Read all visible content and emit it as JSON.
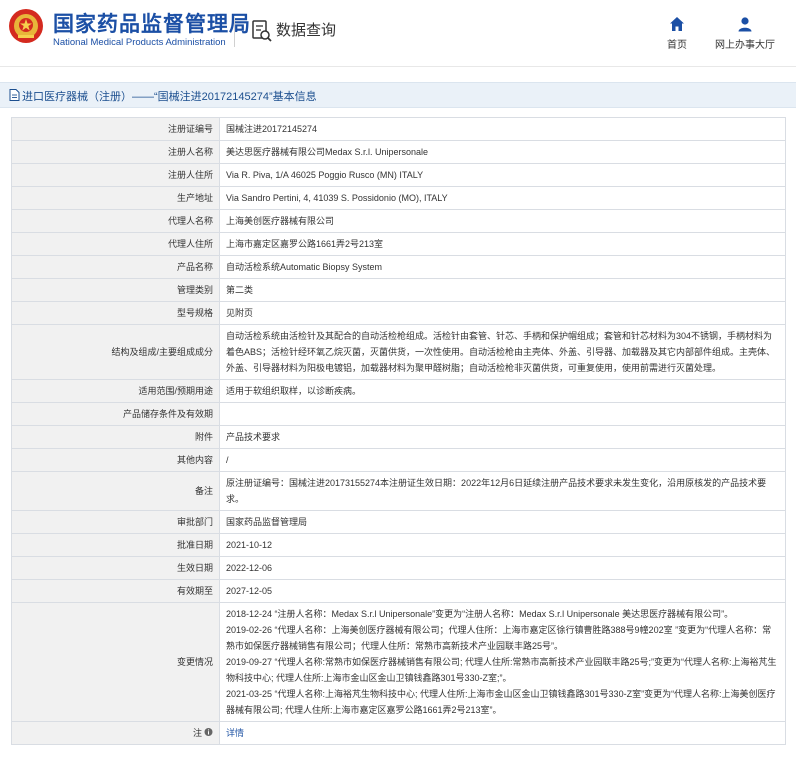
{
  "header": {
    "brand_cn": "国家药品监督管理局",
    "brand_en": "National Medical Products Administration",
    "query_title": "数据查询",
    "nav": {
      "home": "首页",
      "hall": "网上办事大厅"
    }
  },
  "title_bar": {
    "text": "进口医疗器械（注册）——“国械注进20172145274”基本信息"
  },
  "colors": {
    "brand_blue": "#1b4fa5",
    "label_bg": "#f1f1f1",
    "title_bar_bg": "#eaf1f8",
    "link": "#2356a5"
  },
  "rows": [
    {
      "label": "注册证编号",
      "value": "国械注进20172145274"
    },
    {
      "label": "注册人名称",
      "value": "美达思医疗器械有限公司Medax S.r.l. Unipersonale"
    },
    {
      "label": "注册人住所",
      "value": "Via R. Piva, 1/A 46025 Poggio Rusco (MN) ITALY"
    },
    {
      "label": "生产地址",
      "value": "Via Sandro Pertini, 4, 41039 S. Possidonio (MO), ITALY"
    },
    {
      "label": "代理人名称",
      "value": "上海美创医疗器械有限公司"
    },
    {
      "label": "代理人住所",
      "value": "上海市嘉定区嘉罗公路1661弄2号213室"
    },
    {
      "label": "产品名称",
      "value": "自动活检系统Automatic Biopsy System"
    },
    {
      "label": "管理类别",
      "value": "第二类"
    },
    {
      "label": "型号规格",
      "value": "见附页"
    },
    {
      "label": "结构及组成/主要组成成分",
      "value": "自动活检系统由活检针及其配合的自动活检枪组成。活检针由套管、针芯、手柄和保护帽组成；套管和针芯材料为304不锈钢，手柄材料为着色ABS；活检针经环氧乙烷灭菌，灭菌供货，一次性使用。自动活检枪由主壳体、外盖、引导器、加载器及其它内部部件组成。主壳体、外盖、引导器材料为阳极电镀铝，加载器材料为聚甲醛树脂；自动活检枪非灭菌供货，可重复使用，使用前需进行灭菌处理。"
    },
    {
      "label": "适用范围/预期用途",
      "value": "适用于软组织取样，以诊断疾病。"
    },
    {
      "label": "产品储存条件及有效期",
      "value": ""
    },
    {
      "label": "附件",
      "value": "产品技术要求"
    },
    {
      "label": "其他内容",
      "value": "/"
    },
    {
      "label": "备注",
      "value": "原注册证编号：国械注进20173155274本注册证生效日期：2022年12月6日延续注册产品技术要求未发生变化，沿用原核发的产品技术要求。"
    },
    {
      "label": "审批部门",
      "value": "国家药品监督管理局"
    },
    {
      "label": "批准日期",
      "value": "2021-10-12"
    },
    {
      "label": "生效日期",
      "value": "2022-12-06"
    },
    {
      "label": "有效期至",
      "value": "2027-12-05"
    }
  ],
  "changes": {
    "label": "变更情况",
    "items": [
      "2018-12-24 “注册人名称：Medax S.r.l Unipersonale”变更为“注册人名称：Medax S.r.l Unipersonale 美达思医疗器械有限公司”。",
      "2019-02-26 “代理人名称：上海美创医疗器械有限公司；代理人住所：上海市嘉定区徐行镇曹胜路388号9幢202室 ”变更为“代理人名称：常熟市如保医疗器械销售有限公司；代理人住所：常熟市高新技术产业园联丰路25号”。",
      "2019-09-27 “代理人名称:常熟市如保医疗器械销售有限公司; 代理人住所:常熟市高新技术产业园联丰路25号;”变更为“代理人名称:上海裕芃生物科技中心; 代理人住所:上海市金山区金山卫镇钱鑫路301号330-Z室;”。",
      "2021-03-25 “代理人名称:上海裕芃生物科技中心; 代理人住所:上海市金山区金山卫镇钱鑫路301号330-Z室”变更为“代理人名称:上海美创医疗器械有限公司; 代理人住所:上海市嘉定区嘉罗公路1661弄2号213室”。"
    ]
  },
  "notes_row": {
    "label": "注",
    "link": "详情"
  }
}
